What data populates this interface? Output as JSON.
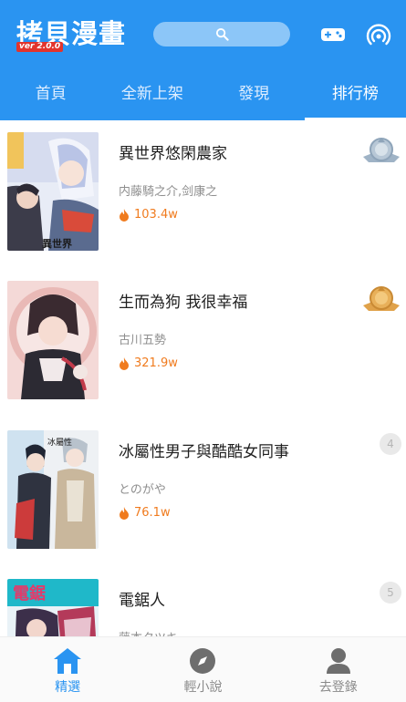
{
  "header": {
    "app_title": "拷貝漫畫",
    "version": "ver 2.0.0",
    "search_icon": "search-icon",
    "game_icon": "gamepad-icon",
    "signal_icon": "signal-icon",
    "bg_color": "#2a94f1"
  },
  "tabs": [
    {
      "label": "首頁"
    },
    {
      "label": "全新上架"
    },
    {
      "label": "發現"
    },
    {
      "label": "排行榜",
      "active": true
    }
  ],
  "ranking": [
    {
      "title": "異世界悠閑農家",
      "author": "内藤騎之介,剑康之",
      "heat": "103.4w",
      "rank": "1",
      "badge": "silver-medal"
    },
    {
      "title": "生而為狗 我很幸福",
      "author": "古川五勢",
      "heat": "321.9w",
      "rank": "2",
      "badge": "bronze-medal"
    },
    {
      "title": "冰屬性男子與酷酷女同事",
      "author": "とのがや",
      "heat": "76.1w",
      "rank": "4",
      "badge": "number"
    },
    {
      "title": "電鋸人",
      "author": "藤本タツキ",
      "heat": "",
      "rank": "5",
      "badge": "number"
    }
  ],
  "bottom_nav": [
    {
      "label": "精選",
      "icon": "home-icon",
      "active": true
    },
    {
      "label": "輕小說",
      "icon": "compass-icon"
    },
    {
      "label": "去登錄",
      "icon": "user-icon"
    }
  ],
  "colors": {
    "accent": "#2a94f1",
    "heat": "#f07b1e",
    "bronze": "#e0a24a",
    "silver": "#9fb3c6"
  }
}
